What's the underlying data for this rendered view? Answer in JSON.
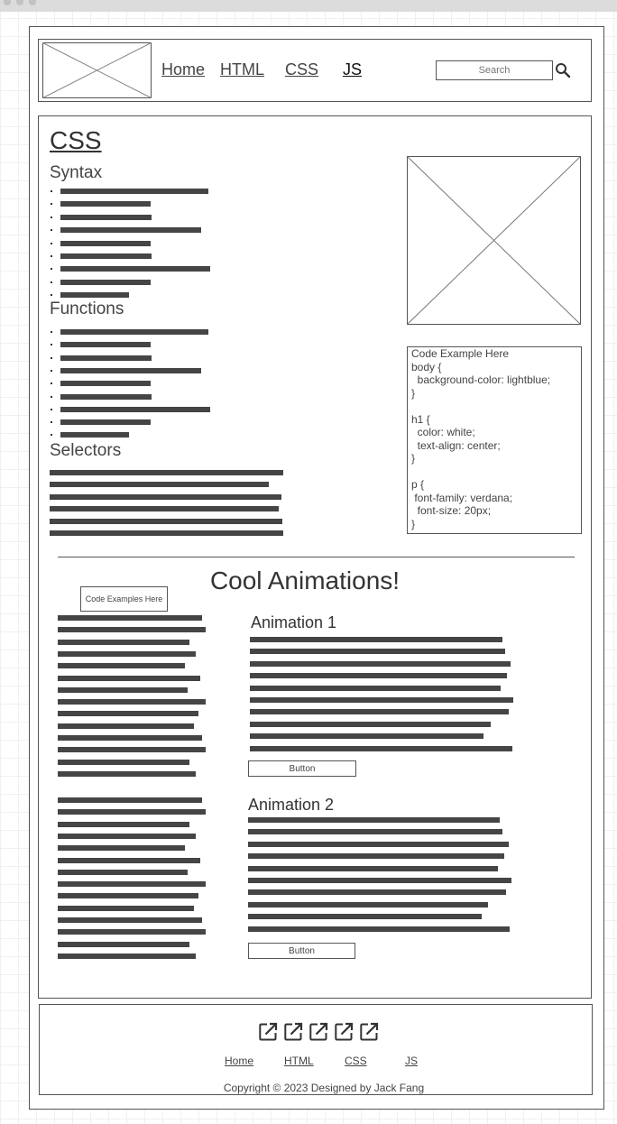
{
  "nav": {
    "home": "Home",
    "html": "HTML",
    "css": "CSS",
    "js": "JS",
    "search_placeholder": "Search"
  },
  "sections": {
    "page_title": "CSS",
    "syntax": "Syntax",
    "functions": "Functions",
    "selectors": "Selectors"
  },
  "code_example": {
    "lines": [
      "Code Example Here",
      "body {",
      "  background-color: lightblue;",
      "}",
      "",
      "h1 {",
      "  color: white;",
      "  text-align: center;",
      "}",
      "",
      "p {",
      " font-family: verdana;",
      "  font-size: 20px;",
      "}"
    ]
  },
  "animations": {
    "heading": "Cool Animations!",
    "code_examples_label": "Code Examples Here",
    "animation1_title": "Animation 1",
    "animation2_title": "Animation 2",
    "button_label": "Button"
  },
  "footer": {
    "links": {
      "home": "Home",
      "html": "HTML",
      "css": "CSS",
      "js": "JS"
    },
    "copyright": "Copyright © 2023 Designed by Jack Fang"
  },
  "icons": {
    "search": "search-icon",
    "external": "external-link-icon",
    "placeholder": "image-placeholder"
  }
}
